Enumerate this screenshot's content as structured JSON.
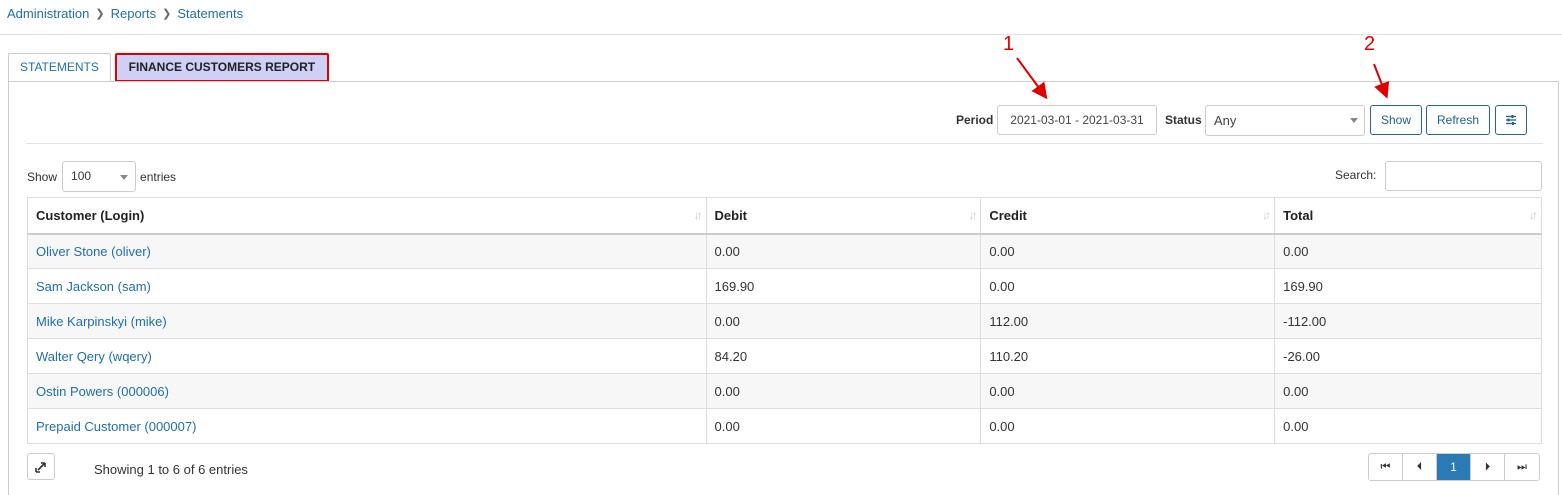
{
  "breadcrumb": {
    "items": [
      "Administration",
      "Reports",
      "Statements"
    ]
  },
  "tabs": [
    {
      "label": "STATEMENTS",
      "active": false
    },
    {
      "label": "FINANCE CUSTOMERS REPORT",
      "active": true
    }
  ],
  "filters": {
    "period_label": "Period",
    "period_value": "2021-03-01 - 2021-03-31",
    "status_label": "Status",
    "status_value": "Any",
    "show_label": "Show",
    "refresh_label": "Refresh",
    "filter_icon": "sliders-icon"
  },
  "table_controls": {
    "show_label": "Show",
    "page_length": "100",
    "entries_label": "entries",
    "search_label": "Search:",
    "search_value": ""
  },
  "table": {
    "columns": [
      "Customer (Login)",
      "Debit",
      "Credit",
      "Total"
    ],
    "rows": [
      [
        "Oliver Stone (oliver)",
        "0.00",
        "0.00",
        "0.00"
      ],
      [
        "Sam Jackson (sam)",
        "169.90",
        "0.00",
        "169.90"
      ],
      [
        "Mike Karpinskyi (mike)",
        "0.00",
        "112.00",
        "-112.00"
      ],
      [
        "Walter Qery (wqery)",
        "84.20",
        "110.20",
        "-26.00"
      ],
      [
        "Ostin Powers (000006)",
        "0.00",
        "0.00",
        "0.00"
      ],
      [
        "Prepaid Customer (000007)",
        "0.00",
        "0.00",
        "0.00"
      ]
    ]
  },
  "footer": {
    "info": "Showing 1 to 6 of 6 entries",
    "current_page": "1",
    "export_icon": "export-icon"
  },
  "annotations": [
    "1",
    "2"
  ],
  "colors": {
    "link": "#1f6fa8",
    "active_tab_bg": "#cfd0f5",
    "highlight_border": "#e10000",
    "page_active": "#2a7ab5",
    "annotation": "#e00000"
  }
}
